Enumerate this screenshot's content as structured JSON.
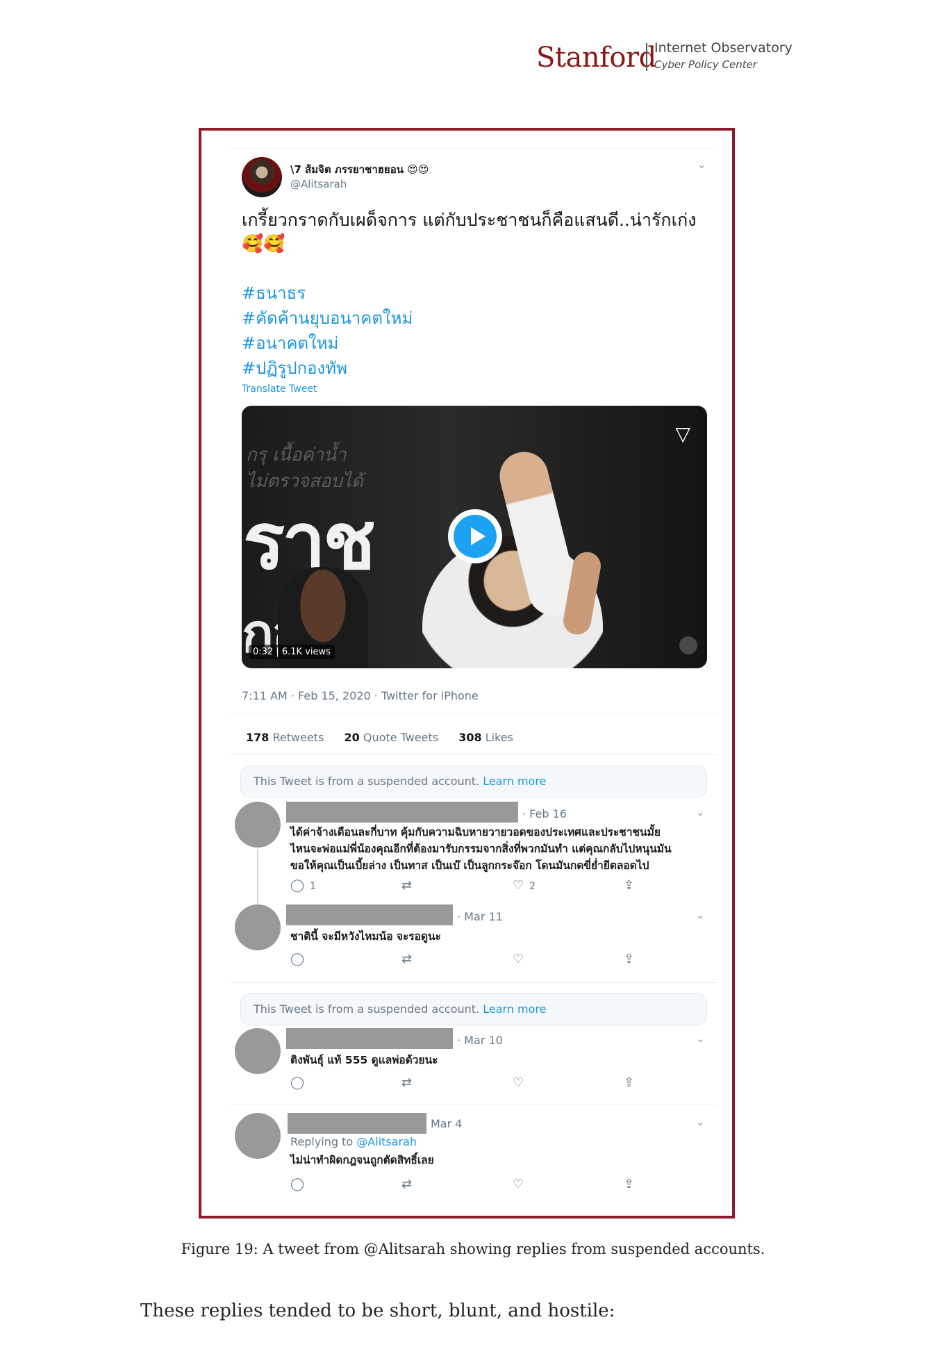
{
  "letterhead": {
    "name": "Stanford",
    "line1": "Internet Observatory",
    "line2": "Cyber Policy Center"
  },
  "tweet": {
    "display_name": "\\7 ส้มจิต ภรรยาชาฮยอน 😍😍",
    "handle": "@Alitsarah",
    "text": "เกรี้ยวกราดกับเผด็จการ แต่กับประชาชนก็คือแสนดี..น่ารักเก่ง 🥰🥰",
    "hashtags": [
      "#ธนาธร",
      "#คัดค้านยุบอนาคตใหม่",
      "#อนาคตใหม่",
      "#ปฏิรูปกองทัพ"
    ],
    "translate": "Translate Tweet",
    "media": {
      "overlay_big": "ราช",
      "overlay_big2": "กอ  พ",
      "overlay_faint_1": "กรุ เนื้อค่าน้ำ",
      "overlay_faint_2": "ไม่ตรวจสอบได้",
      "duration": "0:32",
      "views": "6.1K views"
    },
    "meta": "7:11 AM · Feb 15, 2020 · Twitter for iPhone",
    "stats": {
      "retweets_count": "178",
      "retweets_label": "Retweets",
      "quotes_count": "20",
      "quotes_label": "Quote Tweets",
      "likes_count": "308",
      "likes_label": "Likes"
    }
  },
  "suspended_notice": {
    "text": "This Tweet is from a suspended account.",
    "link": "Learn more"
  },
  "replies": [
    {
      "date": "· Feb 16",
      "lines": [
        "ได้ค่าจ้างเดือนละกี่บาท คุ้มกับความฉิบหายวายวอดของประเทศและประชาชนมั้ย",
        "ไหนจะพ่อแม่พี่น้องคุณอีกที่ต้องมารับกรรมจากสิ่งที่พวกมันทำ แต่คุณกลับไปหนุนมัน",
        "ขอให้คุณเป็นเบี้ยล่าง เป็นทาส เป็นเบ๊ เป็นลูกกระจ๊อก โดนมันกดขี่ย่ำยีตลอดไป"
      ],
      "reply_count": "1",
      "like_count": "2"
    },
    {
      "date": "· Mar 11",
      "lines": [
        "ชาตินี้ จะมีหวังไหมน้อ จะรอดูนะ"
      ],
      "reply_count": "",
      "like_count": ""
    },
    {
      "date": "· Mar 10",
      "lines": [
        "ติงพันธุ์ แท้ 555 ดูแลพ่อด้วยนะ"
      ],
      "reply_count": "",
      "like_count": ""
    },
    {
      "date": "Mar 4",
      "replying_prefix": "Replying to",
      "replying_to": "@Alitsarah",
      "lines": [
        "ไม่น่าทำผิดกฎจนถูกตัดสิทธิ์เลย"
      ],
      "reply_count": "",
      "like_count": ""
    }
  ],
  "icons": {
    "chevron": "⌄",
    "reply": "◯",
    "retweet": "⇄",
    "like": "♡",
    "share": "⇪"
  },
  "caption": "Figure 19: A tweet from @Alitsarah showing replies from suspended accounts.",
  "body_text": "These replies tended to be short, blunt, and hostile:"
}
